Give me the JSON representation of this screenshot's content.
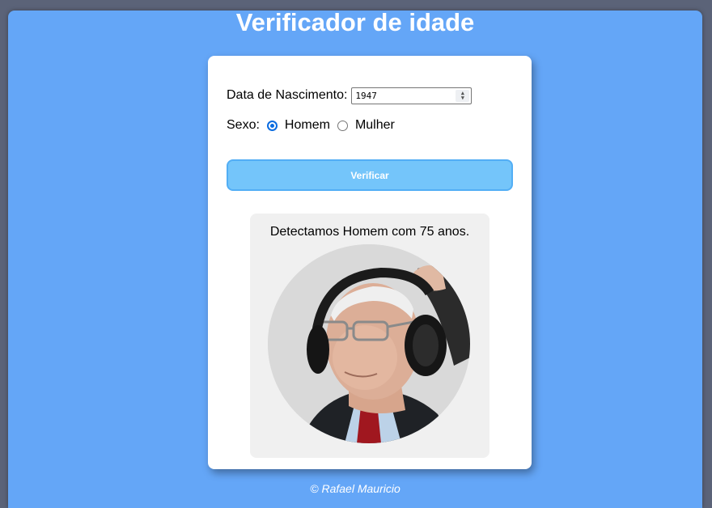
{
  "page": {
    "title": "Verificador de idade",
    "footer": "© Rafael Mauricio"
  },
  "form": {
    "birth_label": "Data de Nascimento:",
    "birth_value": "1947",
    "sex_label": "Sexo:",
    "sex_options": [
      {
        "label": "Homem",
        "selected": true
      },
      {
        "label": "Mulher",
        "selected": false
      }
    ],
    "verify_label": "Verificar"
  },
  "result": {
    "text": "Detectamos Homem com 75 anos.",
    "image_icon": "elderly-man-with-headphones-photo"
  },
  "colors": {
    "background": "#64a6f7",
    "button": "#74c5fa",
    "button_border": "#52aef5",
    "radio_accent": "#0b6ce0",
    "result_bg": "#f0f0f0"
  }
}
